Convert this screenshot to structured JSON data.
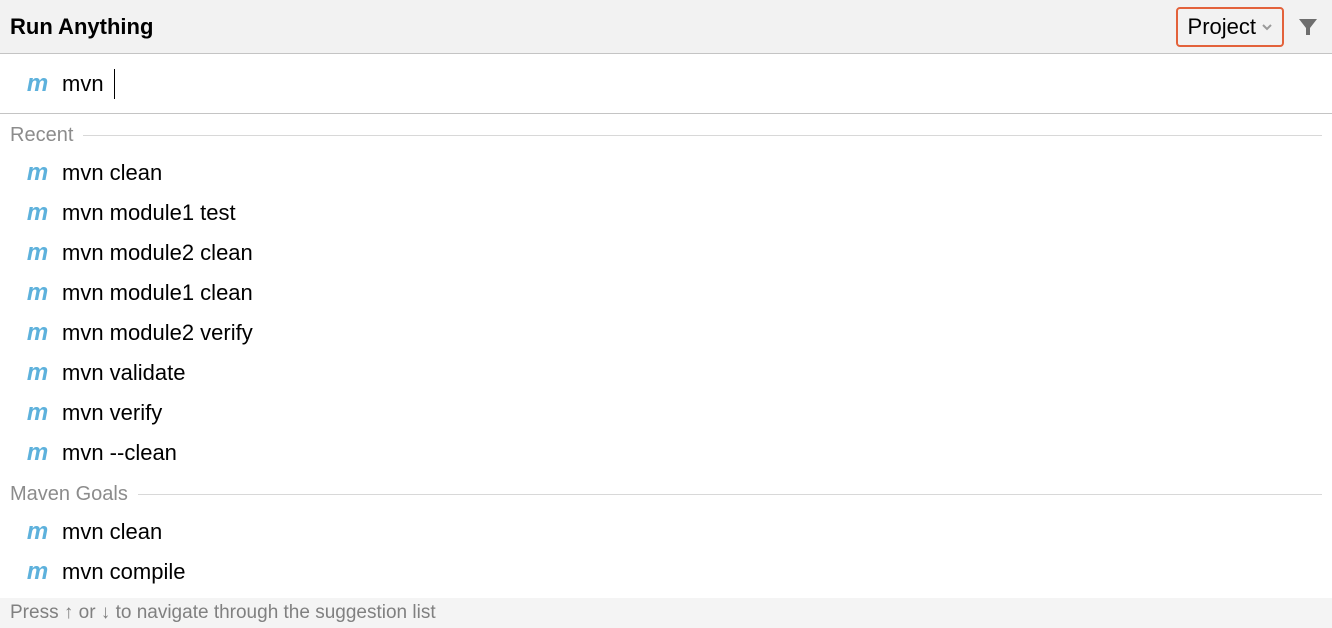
{
  "header": {
    "title": "Run Anything",
    "scope_label": "Project"
  },
  "search": {
    "value": "mvn "
  },
  "sections": [
    {
      "label": "Recent",
      "items": [
        "mvn clean",
        "mvn module1 test",
        "mvn module2 clean",
        "mvn module1 clean",
        "mvn module2 verify",
        "mvn validate",
        "mvn verify",
        "mvn --clean"
      ]
    },
    {
      "label": "Maven Goals",
      "items": [
        "mvn clean",
        "mvn compile"
      ]
    }
  ],
  "footer": {
    "hint": "Press ↑ or ↓ to navigate through the suggestion list"
  }
}
